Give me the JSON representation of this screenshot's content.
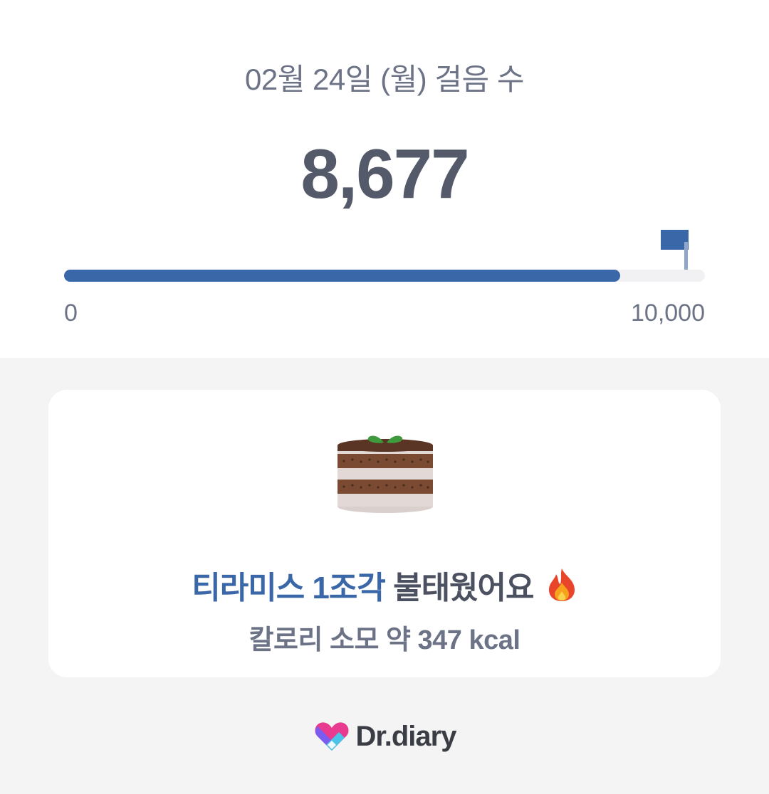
{
  "steps": {
    "date_title": "02월 24일 (월) 걸음 수",
    "count": "8,677",
    "progress_value": 8677,
    "goal_value": 10000,
    "scale_min": "0",
    "scale_max": "10,000"
  },
  "card": {
    "food_icon": "tiramisu-cake-icon",
    "food_text": "티라미스 1조각",
    "burned_text": " 불태웠어요",
    "fire_icon": "fire-icon",
    "calorie_text": "칼로리 소모 약 347 kcal"
  },
  "footer": {
    "logo_icon": "heart-logo-icon",
    "brand": "Dr.diary"
  },
  "colors": {
    "accent": "#3a67a8",
    "text_dark": "#545a6a",
    "text_muted": "#6d7386",
    "background": "#f4f4f4"
  }
}
